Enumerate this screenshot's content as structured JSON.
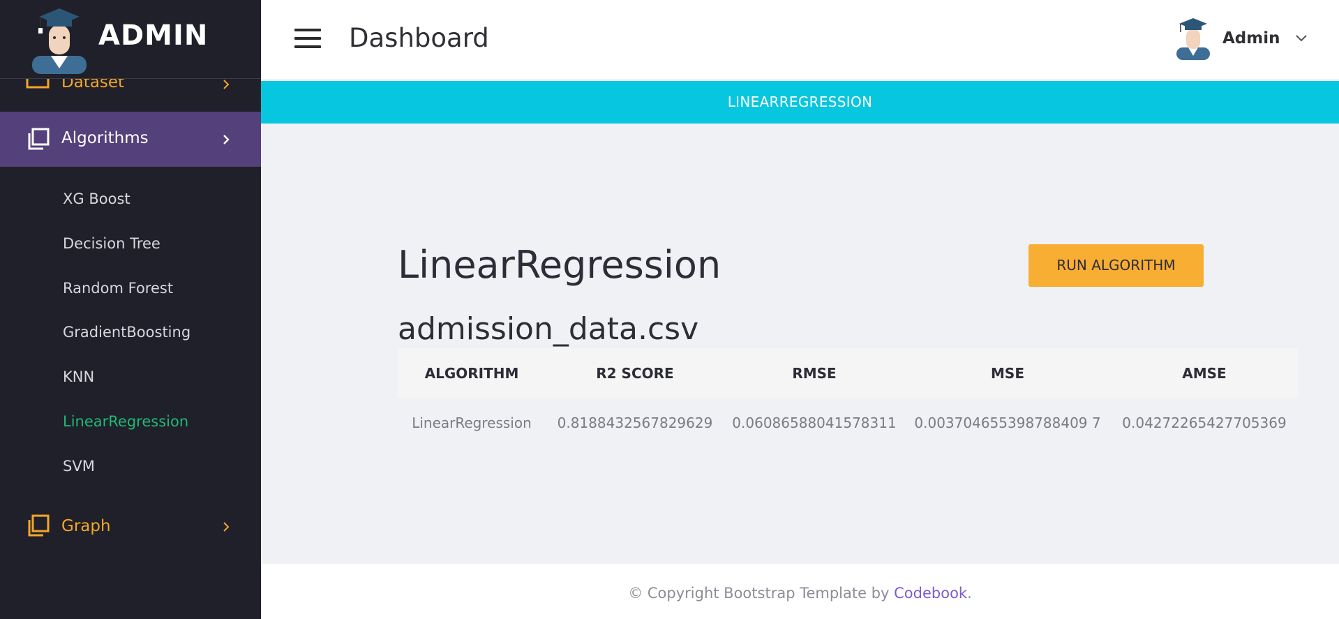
{
  "app": {
    "title": "ADMIN"
  },
  "sidebar": {
    "dataset_label": "Dataset",
    "algorithms_label": "Algorithms",
    "algorithm_items": [
      "XG Boost",
      "Decision Tree",
      "Random Forest",
      "GradientBoosting",
      "KNN",
      "LinearRegression",
      "SVM"
    ],
    "active_item": "LinearRegression",
    "graph_label": "Graph"
  },
  "header": {
    "page_title": "Dashboard",
    "user_name": "Admin"
  },
  "banner": {
    "text": "LINEARREGRESSION"
  },
  "main": {
    "algorithm_title": "LinearRegression",
    "run_button_label": "RUN ALGORITHM",
    "file_name": "admission_data.csv",
    "table": {
      "headers": [
        "ALGORITHM",
        "R2 SCORE",
        "RMSE",
        "MSE",
        "AMSE"
      ],
      "rows": [
        [
          "LinearRegression",
          "0.8188432567829629",
          "0.06086588041578311",
          "0.003704655398788409 7",
          "0.04272265427705369"
        ]
      ]
    }
  },
  "footer": {
    "copyright_text": "© Copyright Bootstrap Template by ",
    "link_text": "Codebook",
    "trailing": "."
  },
  "colors": {
    "sidebar_bg": "#1f2029",
    "active_menu_bg": "#54407a",
    "accent_orange": "#f4a62a",
    "active_sub": "#20b876",
    "banner": "#06c7df",
    "button": "#f8ad33",
    "footer_link": "#7b5bd1"
  }
}
